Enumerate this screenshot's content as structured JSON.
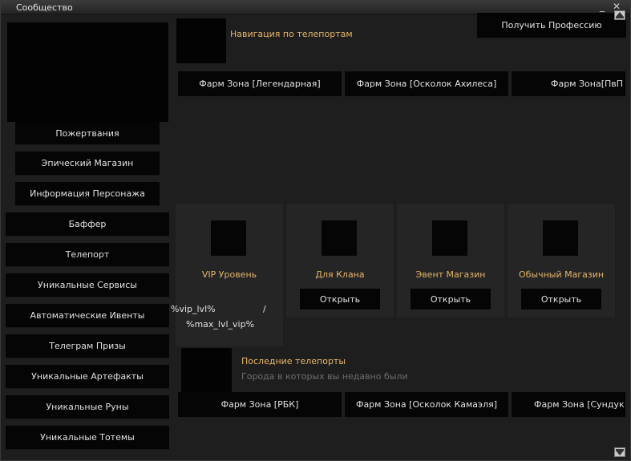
{
  "window": {
    "title": "Сообщество"
  },
  "sidebar": {
    "buttons": [
      "Пожертвания",
      "Эпический Магазин",
      "Информация Персонажа",
      "Баффер",
      "Телепорт",
      "Уникальные Сервисы",
      "Автоматические Ивенты",
      "Телеграм Призы",
      "Уникальные Артефакты",
      "Уникальные Руны",
      "Уникальные Тотемы"
    ]
  },
  "header": {
    "profession_button": "Получить Профессию",
    "teleport_nav_title": "Навигация по телепортам"
  },
  "teleports_top": [
    "Фарм Зона [Легендарная]",
    "Фарм Зона [Осколок Ахилеса]",
    "Фарм Зона[ПвП Ра"
  ],
  "cards": [
    {
      "title": "VIP Уровень",
      "vip_lvl": "%vip_lvl%",
      "separator": "/",
      "max_lvl": "%max_lvl_vip%"
    },
    {
      "title": "Для Клана",
      "button": "Открыть"
    },
    {
      "title": "Эвент Магазин",
      "button": "Открыть"
    },
    {
      "title": "Обычный Магазин",
      "button": "Открыть"
    }
  ],
  "recent": {
    "title": "Последние телепорты",
    "subtitle": "Города в которых вы недавно были"
  },
  "teleports_bottom": [
    "Фарм Зона [РБК]",
    "Фарм Зона [Осколок Камаэля]",
    "Фарм Зона [Сундук - У"
  ]
}
